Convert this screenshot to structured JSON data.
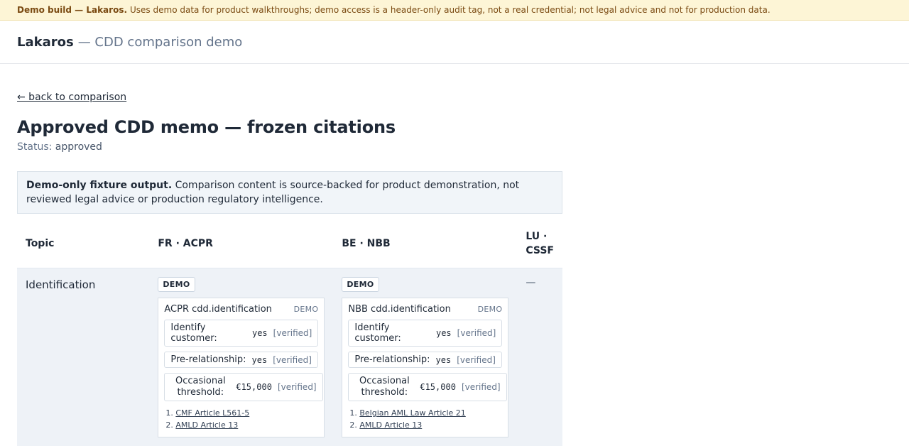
{
  "banner": {
    "strong": "Demo build — Lakaros.",
    "text": "Uses demo data for product walkthroughs; demo access is a header-only audit tag, not a real credential; not legal advice and not for production data."
  },
  "app": {
    "brand": "Lakaros",
    "subtitle": "— CDD comparison demo"
  },
  "nav": {
    "back": "← back to comparison"
  },
  "page": {
    "title": "Approved CDD memo — frozen citations",
    "status_label": "Status:",
    "status_value": "approved"
  },
  "notice": {
    "strong": "Demo-only fixture output.",
    "text": "Comparison content is source-backed for product demonstration, not reviewed legal advice or production regulatory intelligence."
  },
  "table": {
    "headers": [
      "Topic",
      "FR · ACPR",
      "BE · NBB",
      "LU · CSSF"
    ],
    "rows": [
      {
        "topic": "Identification",
        "fr": {
          "badge": "DEMO",
          "card_title": "ACPR cdd.identification",
          "card_tag": "DEMO",
          "fields": [
            {
              "label": "Identify customer:",
              "value": "yes",
              "status": "[verified]"
            },
            {
              "label": "Pre-relationship:",
              "value": "yes",
              "status": "[verified]"
            },
            {
              "label": "Occasional threshold:",
              "value": "€15,000",
              "status": "[verified]"
            }
          ],
          "citations": [
            "CMF Article L561-5",
            "AMLD Article 13"
          ]
        },
        "be": {
          "badge": "DEMO",
          "card_title": "NBB cdd.identification",
          "card_tag": "DEMO",
          "fields": [
            {
              "label": "Identify customer:",
              "value": "yes",
              "status": "[verified]"
            },
            {
              "label": "Pre-relationship:",
              "value": "yes",
              "status": "[verified]"
            },
            {
              "label": "Occasional threshold:",
              "value": "€15,000",
              "status": "[verified]"
            }
          ],
          "citations": [
            "Belgian AML Law Article 21",
            "AMLD Article 13"
          ]
        },
        "lu": "—"
      }
    ]
  }
}
